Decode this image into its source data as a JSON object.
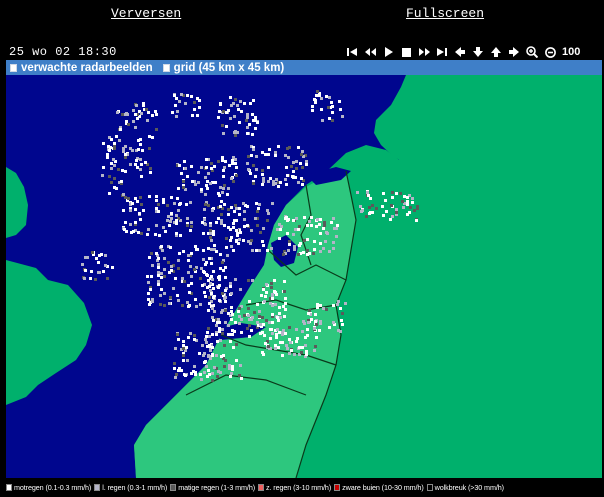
{
  "header": {
    "refresh_label": "Verversen",
    "fullscreen_label": "Fullscreen"
  },
  "timestamp": "25 wo 02 18:30",
  "toolbar": {
    "buttons": [
      "first-frame-icon",
      "rewind-icon",
      "play-icon",
      "stop-icon",
      "fast-forward-icon",
      "last-frame-icon",
      "pan-left-icon",
      "pan-down-icon",
      "pan-up-icon",
      "pan-right-icon",
      "zoom-in-icon",
      "zoom-out-icon"
    ],
    "zoom_level": "100"
  },
  "options": {
    "radar_label": "verwachte radarbeelden",
    "grid_label": "grid (45 km x 45 km)"
  },
  "legend": [
    {
      "label": "motregen (0.1-0.3 mm/h)",
      "color": "#ffffff"
    },
    {
      "label": "l. regen (0.3-1 mm/h)",
      "color": "#b4b4c8"
    },
    {
      "label": "matige regen (1-3 mm/h)",
      "color": "#5a5a5a"
    },
    {
      "label": "z. regen (3-10 mm/h)",
      "color": "#f06060"
    },
    {
      "label": "zware buien (10-30 mm/h)",
      "color": "#c80000"
    },
    {
      "label": "wolkbreuk (>30 mm/h)",
      "color": "#000000"
    }
  ],
  "map_colors": {
    "sea": "#00068e",
    "land": "#00b06c",
    "land_highlight": "#2dc77e"
  }
}
